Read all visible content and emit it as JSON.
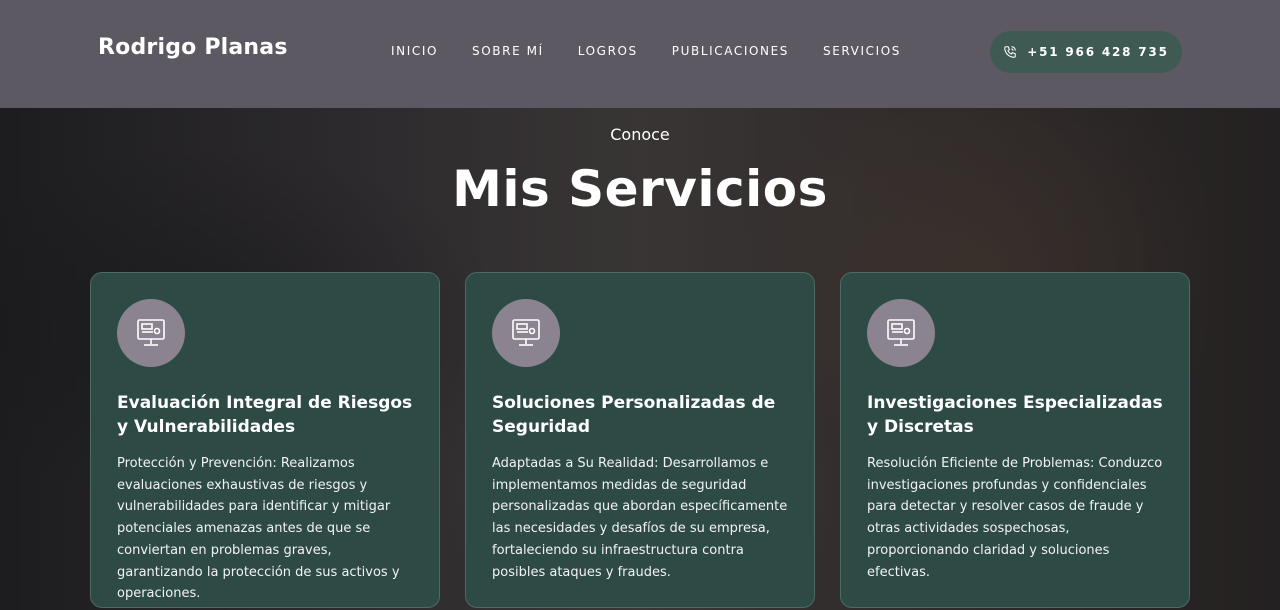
{
  "header": {
    "brand": "Rodrigo Planas",
    "nav": [
      "INICIO",
      "SOBRE MÍ",
      "LOGROS",
      "PUBLICACIONES",
      "SERVICIOS"
    ],
    "phone": "+51 966 428 735",
    "phone_icon": "phone-icon"
  },
  "hero": {
    "eyebrow": "Conoce",
    "title": "Mis Servicios"
  },
  "services": [
    {
      "icon": "monitor-icon",
      "title": "Evaluación Integral de Riesgos y Vulnerabilidades",
      "text": "Protección y Prevención: Realizamos evaluaciones exhaustivas de riesgos y vulnerabilidades para identificar y mitigar potenciales amenazas antes de que se conviertan en problemas graves, garantizando la protección de sus activos y operaciones."
    },
    {
      "icon": "monitor-icon",
      "title": "Soluciones Personalizadas de Seguridad",
      "text": "Adaptadas a Su Realidad: Desarrollamos e implementamos medidas de seguridad personalizadas que abordan específicamente las necesidades y desafíos de su empresa, fortaleciendo su infraestructura contra posibles ataques y fraudes."
    },
    {
      "icon": "monitor-icon",
      "title": "Investigaciones Especializadas y Discretas",
      "text": "Resolución Eficiente de Problemas: Conduzco investigaciones profundas y confidenciales para detectar y resolver casos de fraude y otras actividades sospechosas, proporcionando claridad y soluciones efectivas."
    }
  ],
  "colors": {
    "header_bg": "#5c5962",
    "card_bg": "#2d4a45",
    "phone_bg": "#3f5a52",
    "icon_circle": "#8b8490"
  }
}
